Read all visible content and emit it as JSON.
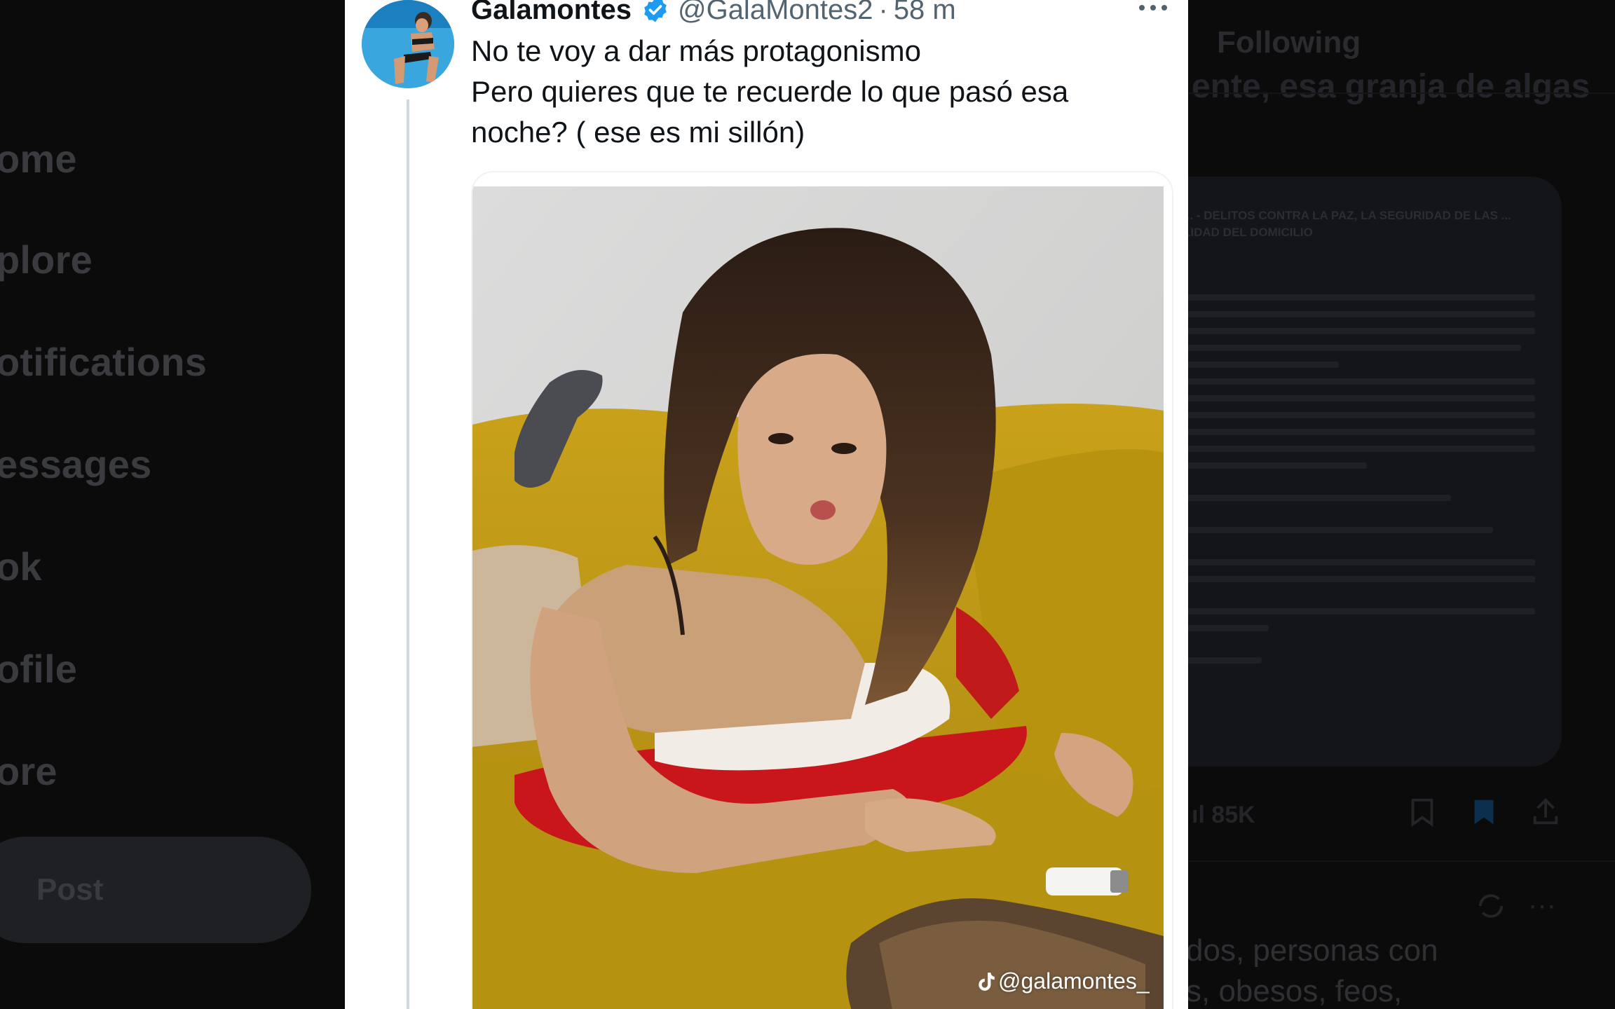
{
  "sidebar": {
    "items": [
      {
        "label": "ome"
      },
      {
        "label": "plore"
      },
      {
        "label": "otifications"
      },
      {
        "label": "essages"
      },
      {
        "label": "ok"
      },
      {
        "label": "ofile"
      },
      {
        "label": "ore"
      }
    ],
    "post_label": "Post"
  },
  "right_panel": {
    "tab_label": "Following",
    "header_text": "ente, esa granja de algas",
    "doc_title": "... - DELITOS CONTRA LA PAZ, LA SEGURIDAD DE LAS ... LIDAD DEL DOMICILIO",
    "views_count": "85K",
    "reply_lines": [
      "dos, personas con",
      "s, obesos, feos,"
    ]
  },
  "tweet": {
    "display_name": "Galamontes",
    "handle": "@GalaMontes2",
    "separator": "·",
    "time": "58 m",
    "text_lines": [
      "No te voy a dar más protagonismo",
      "Pero quieres que te recuerde lo que pasó esa",
      "noche? ( ese es mi sillón)"
    ],
    "media_watermark": "@galamontes_"
  },
  "colors": {
    "verified": "#1d9bf0",
    "text_primary": "#0f1419",
    "text_secondary": "#536471",
    "sofa_yellow": "#c8a317",
    "pillow_red": "#c8161b"
  },
  "icons": [
    "verified-badge-icon",
    "more-icon",
    "tiktok-icon",
    "bookmark-icon",
    "share-icon",
    "repost-icon",
    "analytics-icon"
  ]
}
